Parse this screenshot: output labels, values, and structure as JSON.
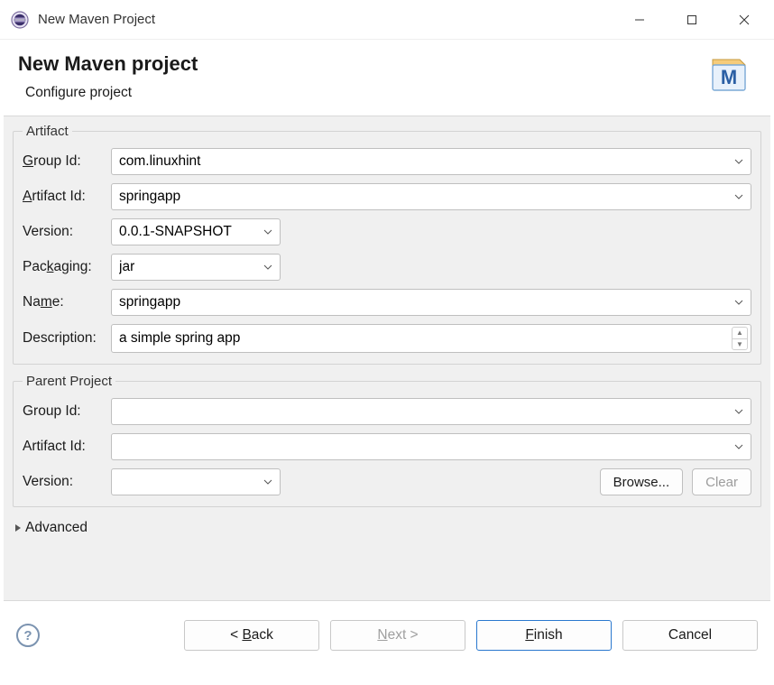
{
  "window": {
    "title": "New Maven Project"
  },
  "banner": {
    "heading": "New Maven project",
    "subtitle": "Configure project"
  },
  "artifact": {
    "legend": "Artifact",
    "group_id_label": "Group Id:",
    "group_id": "com.linuxhint",
    "artifact_id_label": "Artifact Id:",
    "artifact_id": "springapp",
    "version_label": "Version:",
    "version": "0.0.1-SNAPSHOT",
    "packaging_label": "Packaging:",
    "packaging": "jar",
    "name_label": "Name:",
    "name": "springapp",
    "description_label": "Description:",
    "description": "a simple spring app"
  },
  "parent": {
    "legend": "Parent Project",
    "group_id_label": "Group Id:",
    "group_id": "",
    "artifact_id_label": "Artifact Id:",
    "artifact_id": "",
    "version_label": "Version:",
    "version": "",
    "browse": "Browse...",
    "clear": "Clear"
  },
  "advanced_label": "Advanced",
  "footer": {
    "back": "ack",
    "back_prefix": "< ",
    "back_ul": "B",
    "next_prefix": "",
    "next_ul": "N",
    "next": "ext >",
    "finish_ul": "F",
    "finish": "inish",
    "cancel": "Cancel"
  }
}
